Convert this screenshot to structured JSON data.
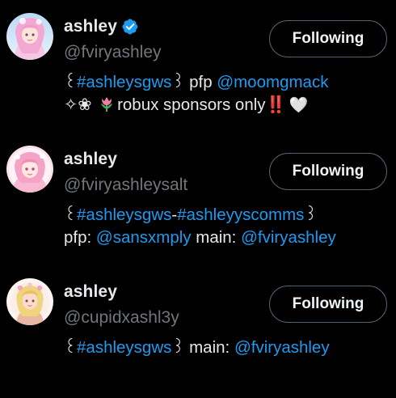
{
  "accounts": [
    {
      "display_name": "ashley",
      "verified": true,
      "handle": "@fviryashley",
      "button_label": "Following",
      "bio": {
        "line1": {
          "open": "꒰",
          "hashtag": "#ashleysgws",
          "close": "꒱",
          "pfp_label": " pfp ",
          "pfp_mention": "@moomgmack"
        },
        "line2": {
          "sparkle": "✧",
          "flower": "❀",
          "tulip_icon": "tulip-emoji",
          "text": "robux sponsors only",
          "exclaim": "‼️",
          "heart": "🤍"
        }
      }
    },
    {
      "display_name": "ashley",
      "verified": false,
      "handle": "@fviryashleysalt",
      "button_label": "Following",
      "bio": {
        "line1": {
          "open": "꒰",
          "hashtag1": "#ashleysgws",
          "dash": "-",
          "hashtag2": "#ashleyyscomms",
          "close": "꒱"
        },
        "line2": {
          "pfp_label": "pfp: ",
          "pfp_mention": "@sansxmply",
          "main_label": " main: ",
          "main_mention": "@fviryashley"
        }
      }
    },
    {
      "display_name": "ashley",
      "verified": false,
      "handle": "@cupidxashl3y",
      "button_label": "Following",
      "bio": {
        "line1": {
          "open": "꒰",
          "hashtag": "#ashleysgws",
          "close": "꒱",
          "main_label": " main: ",
          "main_mention": "@fviryashley"
        }
      }
    }
  ],
  "colors": {
    "background": "#000000",
    "text": "#e7e9ea",
    "secondary": "#71767b",
    "link": "#1d9bf0",
    "button_border": "#536471",
    "verified": "#1d9bf0"
  }
}
